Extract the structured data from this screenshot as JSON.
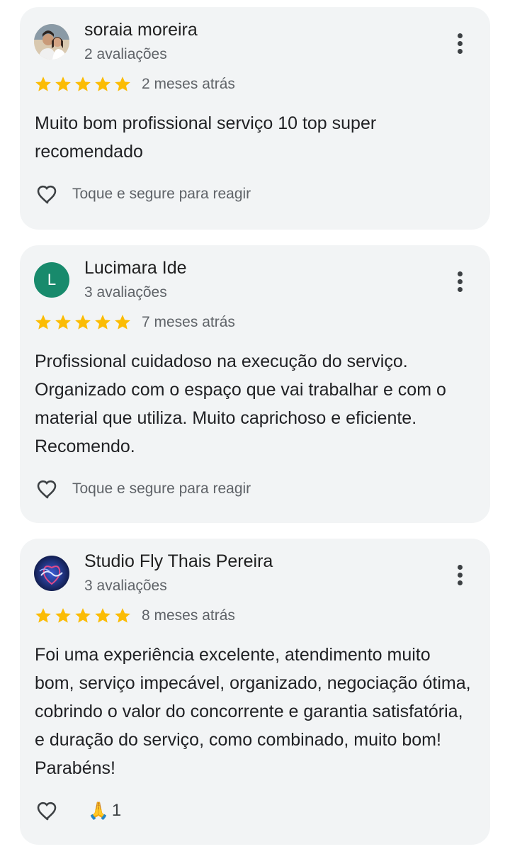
{
  "reviews": [
    {
      "author": "soraia moreira",
      "review_count": "2 avaliações",
      "rating": 5,
      "time": "2 meses atrás",
      "text": "Muito bom profissional serviço 10 top super recomendado",
      "reaction_hint": "Toque e segure para reagir",
      "avatar_icon": "photo-avatar"
    },
    {
      "author": "Lucimara Ide",
      "review_count": "3 avaliações",
      "rating": 5,
      "time": "7 meses atrás",
      "text": "Profissional cuidadoso na execução do serviço. Organizado com o espaço que vai trabalhar e com o material que utiliza. Muito caprichoso e eficiente. Recomendo.",
      "reaction_hint": "Toque e segure para reagir",
      "avatar_letter": "L",
      "avatar_color": "#188a6c"
    },
    {
      "author": "Studio Fly Thais Pereira",
      "review_count": "3 avaliações",
      "rating": 5,
      "time": "8 meses atrás",
      "text": "Foi uma experiência excelente, atendimento muito bom, serviço impecável, organizado, negociação ótima, cobrindo o valor do concorrente e garantia satisfatória, e duração do serviço, como combinado, muito bom! Parabéns!",
      "reaction_emoji": "🙏",
      "reaction_count": "1",
      "avatar_icon": "logo-avatar"
    }
  ],
  "colors": {
    "star": "#fbbc04",
    "card_bg": "#f2f4f5",
    "secondary_text": "#5f6368"
  }
}
